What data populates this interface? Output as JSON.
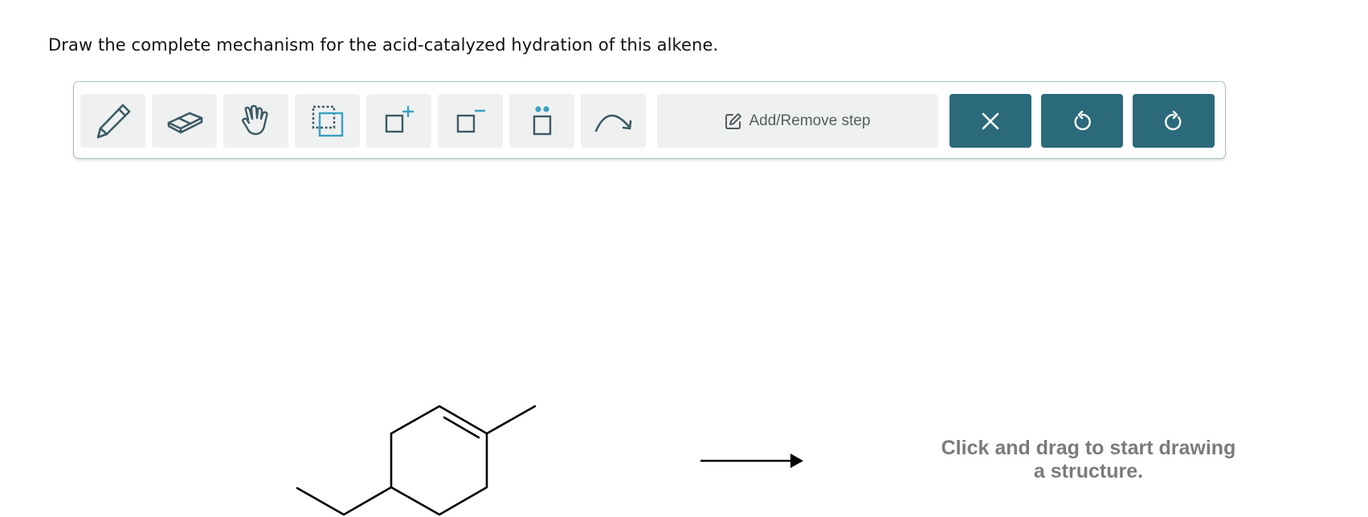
{
  "question": {
    "prompt": "Draw the complete mechanism for the acid-catalyzed hydration of this alkene."
  },
  "toolbar": {
    "tools": [
      {
        "name": "pencil-icon"
      },
      {
        "name": "eraser-icon"
      },
      {
        "name": "hand-icon"
      },
      {
        "name": "select-icon"
      },
      {
        "name": "add-charge-icon"
      },
      {
        "name": "remove-charge-icon"
      },
      {
        "name": "lone-pair-icon"
      },
      {
        "name": "curved-arrow-icon"
      }
    ],
    "step_label": "Add/Remove step",
    "actions": [
      {
        "name": "close-icon"
      },
      {
        "name": "undo-icon"
      },
      {
        "name": "redo-icon"
      }
    ],
    "colors": {
      "icon": "#3d5a66",
      "accent": "#3aa0c1",
      "action_bg": "#2b6a7a",
      "tool_bg": "#eff1f1"
    }
  },
  "canvas": {
    "hint": "Click and drag to start drawing a structure."
  }
}
